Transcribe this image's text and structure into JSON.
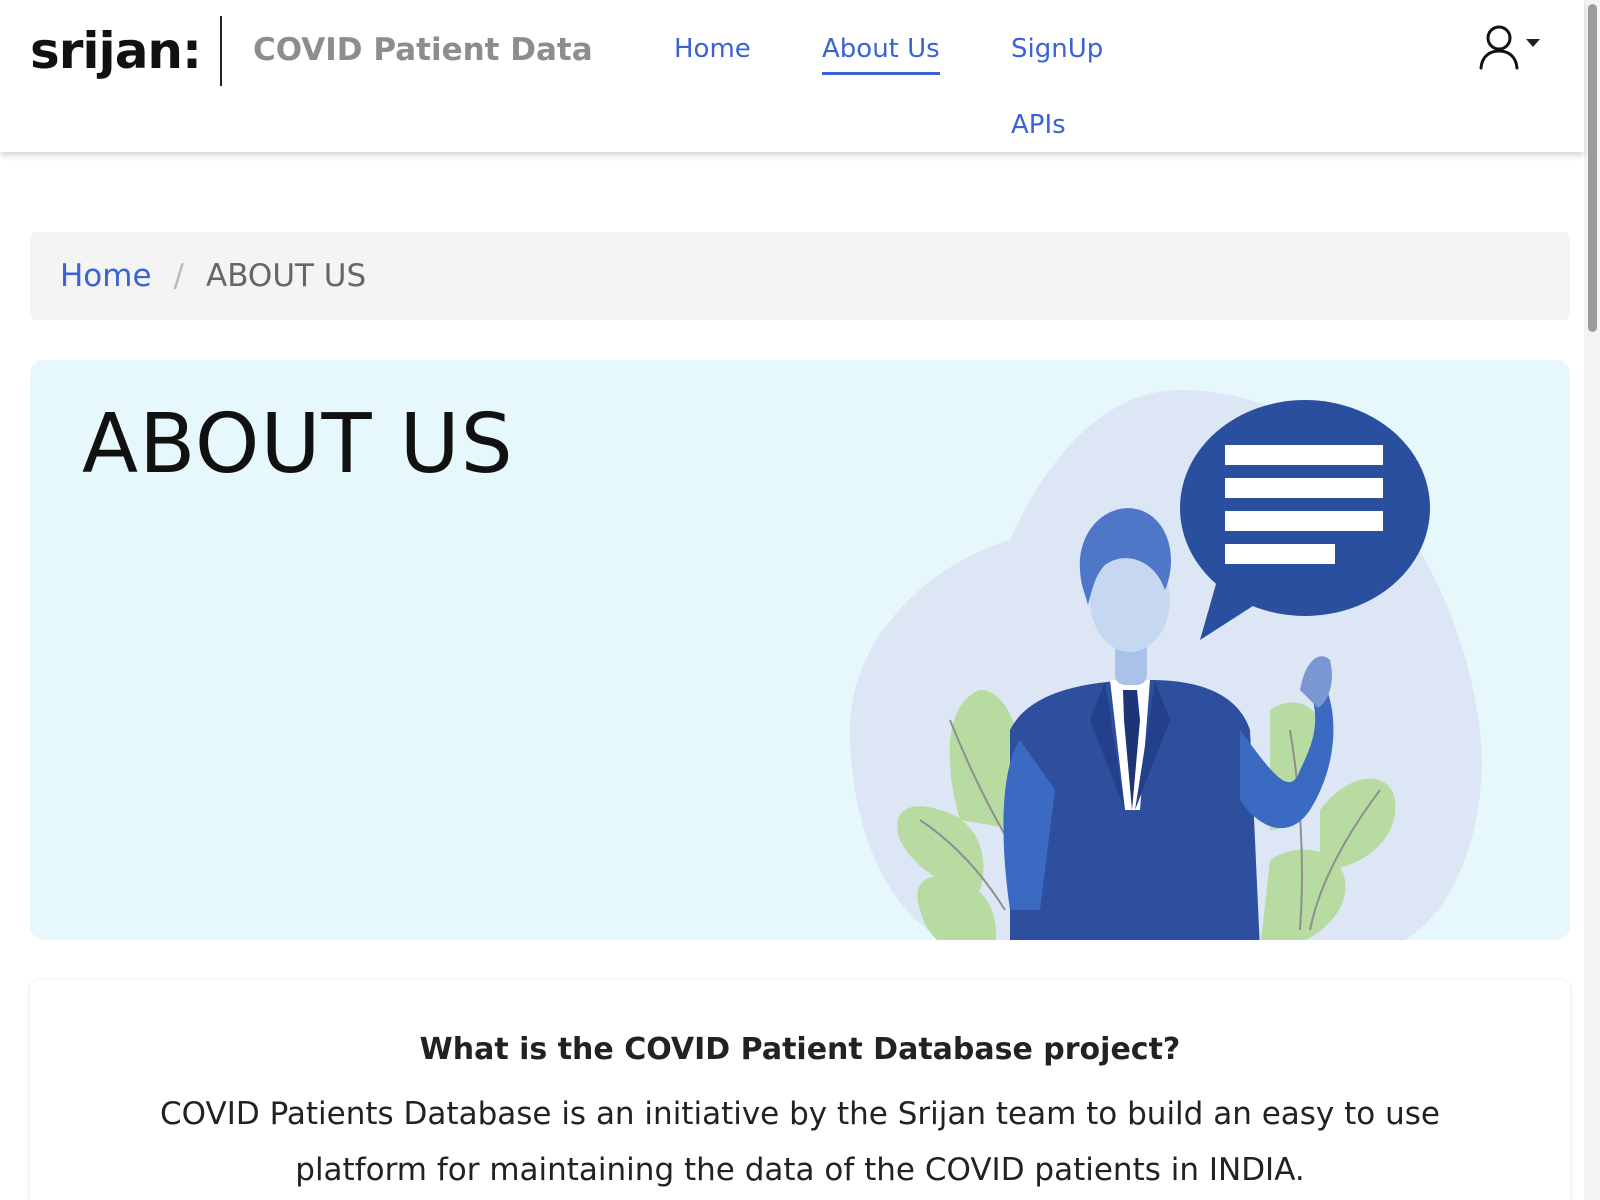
{
  "header": {
    "logo": "srijan:",
    "app_title": "COVID Patient Data",
    "nav": {
      "home": "Home",
      "about": "About Us",
      "signup": "SignUp",
      "apis": "APIs"
    },
    "user_icon": "user-icon",
    "accent_color": "#3b63d3"
  },
  "breadcrumb": {
    "home": "Home",
    "separator": "/",
    "current": "ABOUT US"
  },
  "hero": {
    "title": "ABOUT US",
    "background_color": "#e6f8fc"
  },
  "info": {
    "heading": "What is the COVID Patient Database project?",
    "text": "COVID Patients Database is an initiative by the Srijan team to build an easy to use platform for maintaining the data of the COVID patients in INDIA."
  }
}
